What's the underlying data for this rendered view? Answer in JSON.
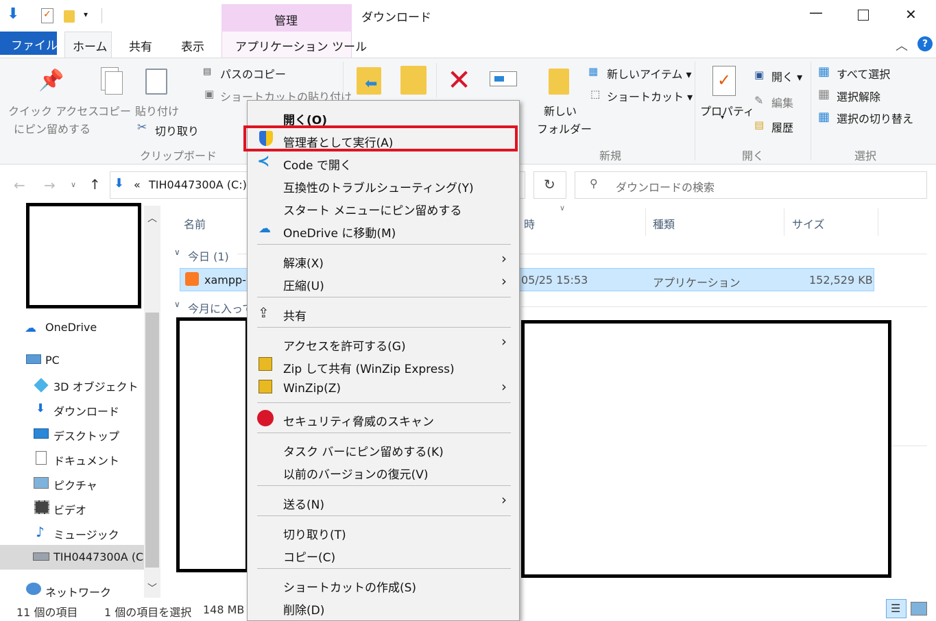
{
  "window": {
    "title": "ダウンロード",
    "context_group": "管理",
    "controls": {
      "minimize": "—",
      "maximize": "☐",
      "close": "✕"
    }
  },
  "tabs": [
    "ファイル",
    "ホーム",
    "共有",
    "表示",
    "アプリケーション ツール"
  ],
  "ribbon": {
    "pin_label_1": "クイック アクセス",
    "pin_label_2": "にピン留めする",
    "copy": "コピー",
    "paste": "貼り付け",
    "copy_path": "パスのコピー",
    "paste_shortcut": "ショートカットの貼り付け",
    "cut": "切り取り",
    "group_clipboard": "クリップボード",
    "new_folder_1": "新しい",
    "new_folder_2": "フォルダー",
    "new_item": "新しいアイテム ▾",
    "shortcut": "ショートカット ▾",
    "group_new": "新規",
    "properties": "プロパティ",
    "open": "開く ▾",
    "edit": "編集",
    "history": "履歴",
    "group_open": "開く",
    "select_all": "すべて選択",
    "select_none": "選択解除",
    "invert_selection": "選択の切り替え",
    "group_select": "選択"
  },
  "address": {
    "path": "TIH0447300A (C:)",
    "prefix": "«",
    "search_placeholder": "ダウンロードの検索"
  },
  "nav": {
    "onedrive": "OneDrive",
    "pc": "PC",
    "objects3d": "3D オブジェクト",
    "downloads": "ダウンロード",
    "desktop": "デスクトップ",
    "documents": "ドキュメント",
    "pictures": "ピクチャ",
    "videos": "ビデオ",
    "music": "ミュージック",
    "drive": "TIH0447300A (C",
    "network": "ネットワーク"
  },
  "columns": {
    "name": "名前",
    "date": "時",
    "type": "種類",
    "size": "サイズ"
  },
  "groups": {
    "today": "今日 (1)",
    "this_month": "今月に入って"
  },
  "file": {
    "name": "xampp-",
    "date": "05/25 15:53",
    "type": "アプリケーション",
    "size": "152,529 KB"
  },
  "status": {
    "count": "11 個の項目",
    "selected": "1 個の項目を選択",
    "size": "148 MB"
  },
  "context_menu": {
    "open": "開く(O)",
    "run_as_admin": "管理者として実行(A)",
    "open_code": "Code で開く",
    "troubleshoot": "互換性のトラブルシューティング(Y)",
    "pin_start": "スタート メニューにピン留めする",
    "onedrive_move": "OneDrive に移動(M)",
    "extract": "解凍(X)",
    "compress": "圧縮(U)",
    "share": "共有",
    "give_access": "アクセスを許可する(G)",
    "zip_share": "Zip して共有 (WinZip Express)",
    "winzip": "WinZip(Z)",
    "security_scan": "セキュリティ脅威のスキャン",
    "pin_taskbar": "タスク バーにピン留めする(K)",
    "restore": "以前のバージョンの復元(V)",
    "send_to": "送る(N)",
    "cut": "切り取り(T)",
    "copy": "コピー(C)",
    "create_shortcut": "ショートカットの作成(S)",
    "delete": "削除(D)"
  },
  "colors": {
    "accent": "#1a63c3",
    "highlight_box": "#e01322",
    "selection": "#cce8ff"
  }
}
